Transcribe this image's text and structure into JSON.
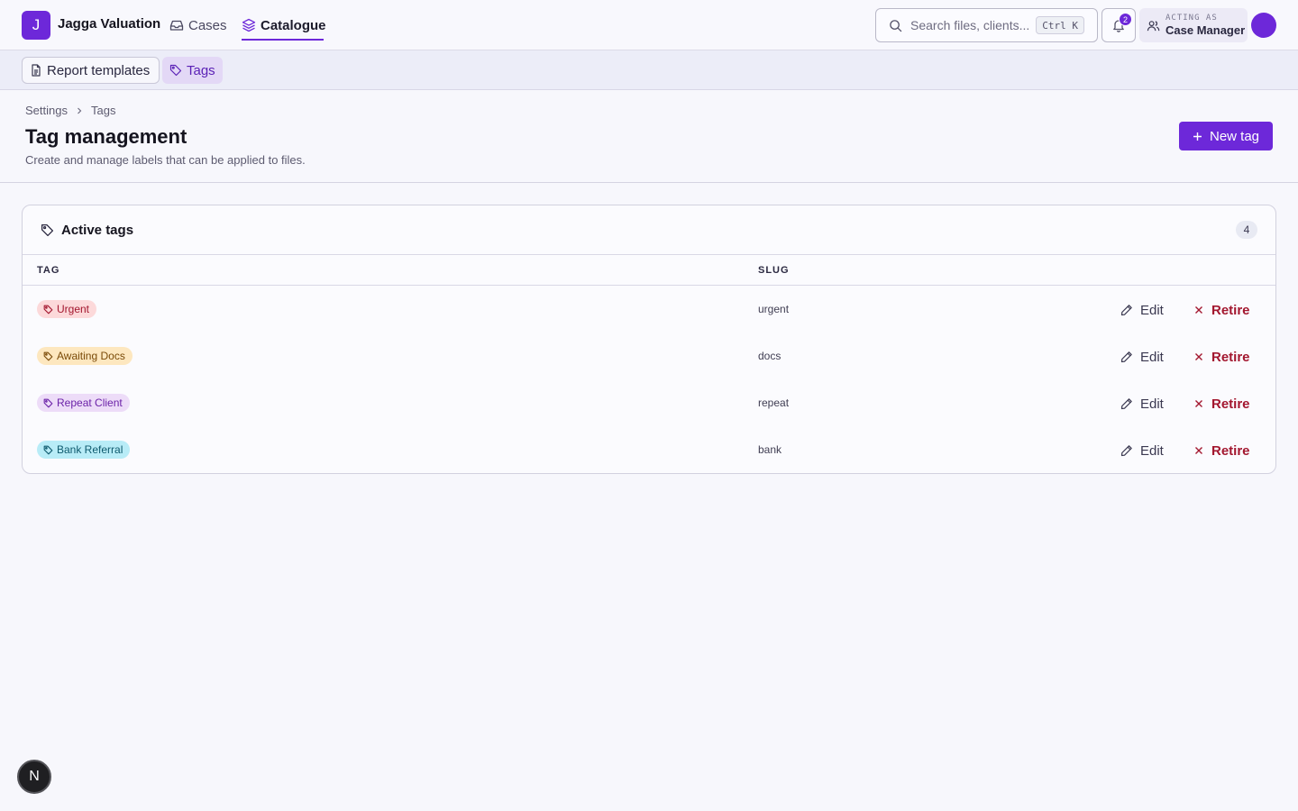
{
  "app": {
    "logo_letter": "J",
    "brand": "Jagga Valuation",
    "nav": {
      "cases": "Cases",
      "catalogue": "Catalogue"
    },
    "search": {
      "placeholder": "Search files, clients...",
      "shortcut": "Ctrl K"
    },
    "notifications": {
      "count": "2",
      "icon": "bell-icon"
    },
    "acting_as": {
      "label": "ACTING AS",
      "role": "Case Manager"
    },
    "accent_color": "#6d28d9"
  },
  "subnav": {
    "report_templates": "Report templates",
    "tags": "Tags"
  },
  "page": {
    "breadcrumb": [
      "Settings",
      "Tags"
    ],
    "title": "Tag management",
    "subtitle": "Create and manage labels that can be applied to files.",
    "new_button": "New tag"
  },
  "card": {
    "title": "Active tags",
    "count": "4",
    "columns": {
      "tag": "TAG",
      "slug": "SLUG"
    },
    "rows": [
      {
        "name": "Urgent",
        "slug": "urgent",
        "bg": "#fcd9da",
        "fg": "#a3172f"
      },
      {
        "name": "Awaiting Docs",
        "slug": "docs",
        "bg": "#fde7bf",
        "fg": "#7a4a08"
      },
      {
        "name": "Repeat Client",
        "slug": "repeat",
        "bg": "#eddcf8",
        "fg": "#6b21a8"
      },
      {
        "name": "Bank Referral",
        "slug": "bank",
        "bg": "#b8ecf7",
        "fg": "#0e5a6e"
      }
    ],
    "edit_label": "Edit",
    "retire_label": "Retire",
    "retire_color": "#a3172f"
  },
  "floating_button": {
    "label": "N"
  }
}
